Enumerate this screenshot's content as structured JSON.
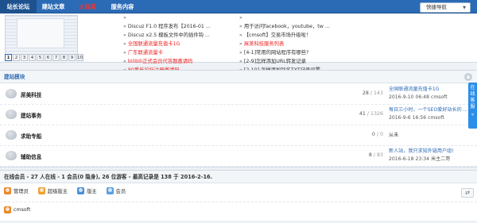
{
  "nav": {
    "tabs": [
      {
        "label": "站长论坛",
        "state": "active"
      },
      {
        "label": "建站文章",
        "state": "normal"
      },
      {
        "label": "大屏幕",
        "state": "hot"
      },
      {
        "label": "服务内容",
        "state": "normal"
      }
    ],
    "quick_nav": "快捷导航"
  },
  "upper": {
    "pager": [
      "1",
      "2",
      "3",
      "4",
      "5",
      "6",
      "7",
      "8",
      "9",
      "10"
    ],
    "current_page": "1",
    "col1": [
      {
        "text": "",
        "style": "ghost"
      },
      {
        "text": "Discuz F1.0 程序发布【2016-01 ...",
        "style": "normal"
      },
      {
        "text": "Discuz x2.5 模板文件中的插件钩 ...",
        "style": "normal"
      },
      {
        "text": "全国联通流量充值卡1G",
        "style": "red"
      },
      {
        "text": "广东联通流量卡",
        "style": "red"
      },
      {
        "text": "bilibili正式会员代答题邀请码",
        "style": "red"
      },
      {
        "text": "80番乐论坛注册邀请码",
        "style": "red"
      }
    ],
    "col2": [
      {
        "text": "",
        "style": "ghost"
      },
      {
        "text": "用于访问facebook，youtube，tw ...",
        "style": "normal"
      },
      {
        "text": "【cmsoft】交易市场升级啦！",
        "style": "normal"
      },
      {
        "text": "屌美科技服务列表",
        "style": "red"
      },
      {
        "text": "[4-1]常用的网站程序有哪些?",
        "style": "normal"
      },
      {
        "text": "[2-9]怎样添加URL转发记录",
        "style": "normal"
      },
      {
        "text": "[2-10] 怎样添加别名TXT记录设置",
        "style": "normal"
      }
    ]
  },
  "block": {
    "title": "建站模块",
    "forums": [
      {
        "name": "屌美科技",
        "threads": "28",
        "posts": "143",
        "last_title": "全国联通流量充值卡1G",
        "last_meta": "2016-9-10 06:48 cmsoft"
      },
      {
        "name": "建站事务",
        "threads": "41",
        "posts": "1326",
        "last_title": "每日三小时，一个SEO爱好站长的 ...",
        "last_meta": "2016-9-6 16:56 cmsoft"
      },
      {
        "name": "求助专船",
        "threads": "0",
        "posts": "0",
        "last_title": "从未",
        "last_meta": ""
      },
      {
        "name": "辅助信息",
        "threads": "8",
        "posts": "83",
        "last_title": "新人站，我只求知外链用户组!",
        "last_meta": "2016-6-18 23:34 米主二哥"
      }
    ]
  },
  "side_float": "在线客服",
  "online": {
    "summary": "在线会员 - 27 人在线 - 1 会员(0 隐身), 26 位游客 - 最高记录是 138 于 2016-2-16.",
    "legend": [
      {
        "label": "管理员",
        "color": "#e8892a"
      },
      {
        "label": "超级版主",
        "color": "#f0a030"
      },
      {
        "label": "版主",
        "color": "#4a90d9"
      },
      {
        "label": "会员",
        "color": "#5aa0e0"
      }
    ],
    "members": [
      {
        "name": "cmsoft",
        "color": "#e8892a"
      }
    ]
  }
}
